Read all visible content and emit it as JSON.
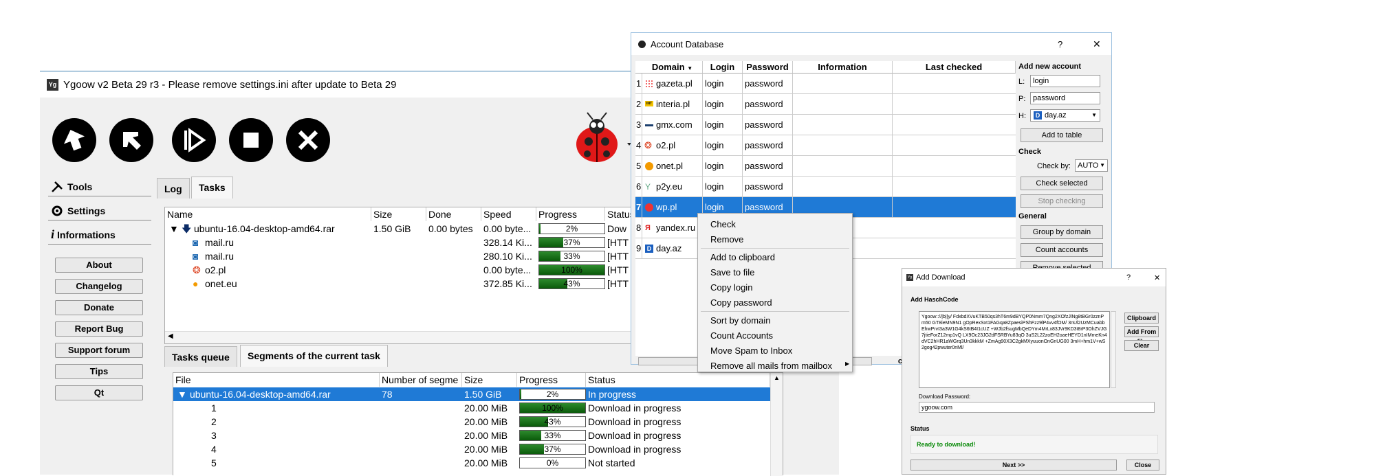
{
  "main_window": {
    "title": "Ygoow v2 Beta 29 r3 - Please remove settings.ini after update to Beta 29",
    "app_icon_text": "Yg",
    "sidebar_tabs": [
      "Tools",
      "Settings",
      "Informations"
    ],
    "sidebar_buttons": [
      "About",
      "Changelog",
      "Donate",
      "Report Bug",
      "Support forum",
      "Tips",
      "Qt"
    ],
    "top_tabs": [
      "Log",
      "Tasks"
    ],
    "task_columns": [
      "Name",
      "Size",
      "Done",
      "Speed",
      "Progress",
      "Status"
    ],
    "tasks": [
      {
        "name": "ubuntu-16.04-desktop-amd64.rar",
        "size": "1.50 GiB",
        "done": "0.00 bytes",
        "speed": "0.00 byte...",
        "progress": 2,
        "status": "Dow"
      },
      {
        "name": "mail.ru",
        "size": "",
        "done": "",
        "speed": "328.14 Ki...",
        "progress": 37,
        "status": "[HTT"
      },
      {
        "name": "mail.ru",
        "size": "",
        "done": "",
        "speed": "280.10 Ki...",
        "progress": 33,
        "status": "[HTT"
      },
      {
        "name": "o2.pl",
        "size": "",
        "done": "",
        "speed": "0.00 byte...",
        "progress": 100,
        "status": "[HTT"
      },
      {
        "name": "onet.eu",
        "size": "",
        "done": "",
        "speed": "372.85 Ki...",
        "progress": 43,
        "status": "[HTT"
      }
    ],
    "bottom_tabs": [
      "Tasks queue",
      "Segments of the current task"
    ],
    "segment_columns": [
      "File",
      "Number of segme",
      "Size",
      "Progress",
      "Status"
    ],
    "segments": [
      {
        "file": "ubuntu-16.04-desktop-amd64.rar",
        "number": "78",
        "size": "1.50 GiB",
        "progress": 2,
        "status": "In progress"
      },
      {
        "file": "1",
        "number": "",
        "size": "20.00 MiB",
        "progress": 100,
        "status": "Download in progress"
      },
      {
        "file": "2",
        "number": "",
        "size": "20.00 MiB",
        "progress": 43,
        "status": "Download in progress"
      },
      {
        "file": "3",
        "number": "",
        "size": "20.00 MiB",
        "progress": 33,
        "status": "Download in progress"
      },
      {
        "file": "4",
        "number": "",
        "size": "20.00 MiB",
        "progress": 37,
        "status": "Download in progress"
      },
      {
        "file": "5",
        "number": "",
        "size": "20.00 MiB",
        "progress": 0,
        "status": "Not started"
      }
    ]
  },
  "account_db": {
    "title": "Account Database",
    "help": "?",
    "close": "✕",
    "columns": [
      "Domain",
      "Login",
      "Password",
      "Information",
      "Last checked"
    ],
    "rows": [
      {
        "n": "1",
        "domain": "gazeta.pl",
        "login": "login",
        "password": "password"
      },
      {
        "n": "2",
        "domain": "interia.pl",
        "login": "login",
        "password": "password"
      },
      {
        "n": "3",
        "domain": "gmx.com",
        "login": "login",
        "password": "password"
      },
      {
        "n": "4",
        "domain": "o2.pl",
        "login": "login",
        "password": "password"
      },
      {
        "n": "5",
        "domain": "onet.pl",
        "login": "login",
        "password": "password"
      },
      {
        "n": "6",
        "domain": "p2y.eu",
        "login": "login",
        "password": "password"
      },
      {
        "n": "7",
        "domain": "wp.pl",
        "login": "login",
        "password": "password"
      },
      {
        "n": "8",
        "domain": "yandex.ru",
        "login": "",
        "password": ""
      },
      {
        "n": "9",
        "domain": "day.az",
        "login": "",
        "password": ""
      }
    ],
    "side": {
      "add_new_account": "Add new account",
      "l_label": "L:",
      "l_value": "login",
      "p_label": "P:",
      "p_value": "password",
      "h_label": "H:",
      "h_value": "day.az",
      "add_to_table": "Add to table",
      "check": "Check",
      "check_by": "Check by:",
      "check_by_value": "AUTO",
      "check_selected": "Check selected",
      "stop_checking": "Stop checking",
      "general": "General",
      "group_by_domain": "Group by domain",
      "count_accounts": "Count accounts",
      "remove_selected": "Remove selected"
    },
    "bottom_button_partial": "ccounts"
  },
  "context_menu": {
    "items": [
      "Check",
      "Remove",
      "Add to clipboard",
      "Save to file",
      "Copy login",
      "Copy password",
      "Sort by domain",
      "Count Accounts",
      "Move Spam to Inbox",
      "Remove all mails from mailbox"
    ]
  },
  "add_download": {
    "title": "Add Download",
    "help": "?",
    "close": "✕",
    "add_hashcode": "Add HaschCode",
    "hash_text": "Ygoow:://|b||y/ FdxbdXVuKTB50qs3hT6m9dBYQP0Nmm7Qng2XOfzJlNg8tBGr0zznPm50 GT8ieMN9N1 gOpRexSxt1FAGqa8ZpaesiPShFzz9lP4vv4fOM/ 3nUl2UzMCuabbEhwPrvI3a3W1G4kS6tB4I1cUZ +WJb2fsugMbQeDYm4MrLx83JVr9KD3t8rP3OhZVJG7jtieForZ12mp1vQ LX9Oc23JG2dFSRBYu83qO 3uS2L22zoEH2oaeHEYD1nIMmeKn4dVC2hHR1aWGrq3Un3kkkM +ZmAg90X3C2gkMXyuuonOnGnUG00 3mH+hm1V+wS2gog42pwuter0nMl/",
    "clipboard": "Clipboard",
    "add_from_file": "Add From file",
    "clear": "Clear",
    "download_password_label": "Download Password:",
    "download_password": "ygoow.com",
    "status_label": "Status",
    "status_text": "Ready to download!",
    "next": "Next >>",
    "close_btn": "Close"
  }
}
